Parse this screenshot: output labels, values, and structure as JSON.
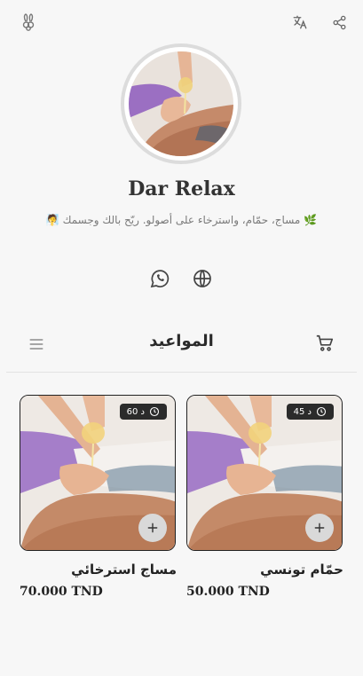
{
  "topbar": {
    "logo_icon": "bunny-logo-icon",
    "translate_icon": "translate-icon",
    "share_icon": "share-icon"
  },
  "profile": {
    "name": "Dar Relax",
    "tagline": "🌿 مساج، حمّام، واسترخاء على أصولو. ريّح بالك وجسمك 🧖",
    "avatar_alt": "massage oil photo"
  },
  "social": {
    "whatsapp_icon": "whatsapp-icon",
    "website_icon": "globe-icon"
  },
  "menubar": {
    "menu_icon": "hamburger-icon",
    "title": "المواعيد",
    "cart_icon": "cart-icon"
  },
  "services": [
    {
      "name": "حمّام تونسي",
      "price": "50.000 TND",
      "duration": "45 د"
    },
    {
      "name": "مساج استرخائي",
      "price": "70.000 TND",
      "duration": "60 د"
    }
  ],
  "colors": {
    "background": "#f7f7f7",
    "badge": "#2b2b2b",
    "add_button": "#d9d9d9"
  }
}
